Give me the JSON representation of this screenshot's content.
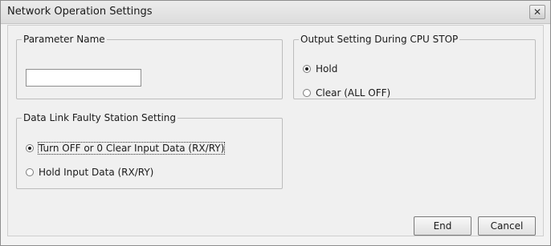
{
  "window": {
    "title": "Network Operation Settings",
    "close_glyph": "✕"
  },
  "parameter_name": {
    "legend": "Parameter Name",
    "value": ""
  },
  "output_setting": {
    "legend": "Output Setting During CPU STOP",
    "options": [
      {
        "label": "Hold",
        "selected": true
      },
      {
        "label": "Clear (ALL OFF)",
        "selected": false
      }
    ]
  },
  "data_link": {
    "legend": "Data Link Faulty Station Setting",
    "options": [
      {
        "label": "Turn OFF or 0 Clear Input Data (RX/RY)",
        "selected": true
      },
      {
        "label": "Hold Input Data (RX/RY)",
        "selected": false
      }
    ]
  },
  "buttons": {
    "end_label": "End",
    "cancel_label": "Cancel"
  }
}
